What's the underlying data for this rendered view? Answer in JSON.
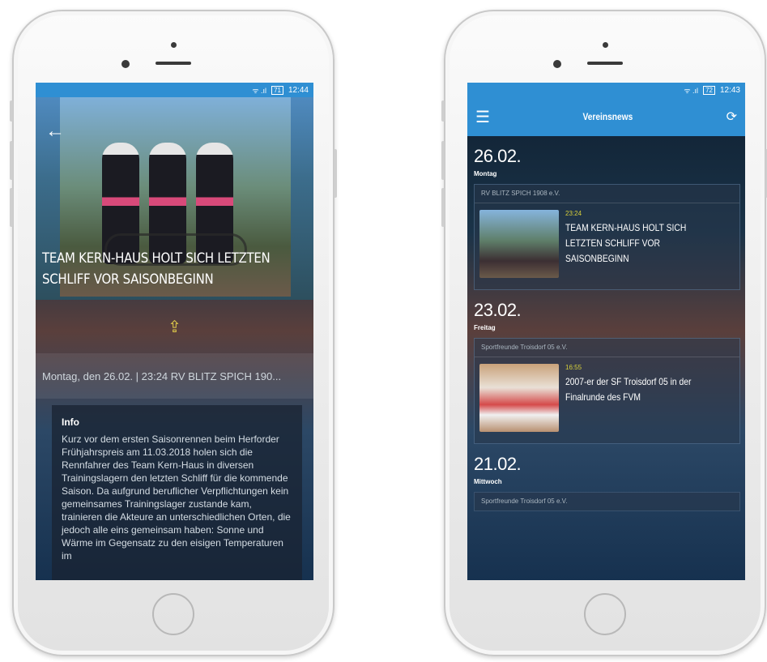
{
  "left": {
    "status": {
      "icons": "ᯤ .ıl",
      "battery": "71",
      "time": "12:44"
    },
    "article": {
      "title": "TEAM KERN-HAUS HOLT SICH LETZTEN SCHLIFF VOR SAISONBEGINN",
      "meta": "Montag, den 26.02. | 23:24    RV BLITZ SPICH 190...",
      "info_heading": "Info",
      "info_text": "Kurz vor dem ersten Saisonrennen beim Herforder Frühjahrspreis am 11.03.2018 holen sich die Rennfahrer des Team Kern-Haus in diversen Trainingslagern den letzten Schliff für die kommende Saison. Da aufgrund beruflicher Verpflichtungen kein gemeinsames Trainingslager zustande kam, trainieren die Akteure an unterschiedlichen Orten, die jedoch alle eins gemeinsam haben: Sonne und Wärme im Gegensatz zu den eisigen Temperaturen im"
    },
    "icons": {
      "back": "←",
      "share": "⇪"
    }
  },
  "right": {
    "status": {
      "icons": "ᯤ .ıl",
      "battery": "72",
      "time": "12:43"
    },
    "appbar": {
      "title": "Vereinsnews",
      "menu_icon": "☰",
      "sync_icon": "⟳"
    },
    "groups": [
      {
        "date": "26.02.",
        "day": "Montag",
        "club": "RV BLITZ SPICH 1908 e.V.",
        "time": "23:24",
        "headline": "TEAM KERN-HAUS HOLT SICH LETZTEN SCHLIFF VOR SAISONBEGINN"
      },
      {
        "date": "23.02.",
        "day": "Freitag",
        "club": "Sportfreunde Troisdorf 05 e.V.",
        "time": "16:55",
        "headline": "2007-er der SF Troisdorf 05 in der Finalrunde des FVM"
      },
      {
        "date": "21.02.",
        "day": "Mittwoch",
        "club": "Sportfreunde Troisdorf 05 e.V."
      }
    ]
  }
}
